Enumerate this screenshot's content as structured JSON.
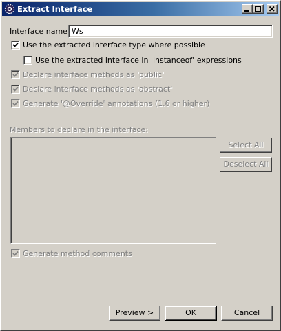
{
  "window": {
    "title": "Extract Interface"
  },
  "form": {
    "interface_name_label": "Interface name:",
    "interface_name_value": "Ws",
    "use_extracted_type": {
      "label": "Use the extracted interface type where possible",
      "checked": true,
      "enabled": true
    },
    "use_in_instanceof": {
      "label": "Use the extracted interface in 'instanceof' expressions",
      "checked": false,
      "enabled": true
    },
    "declare_public": {
      "label": "Declare interface methods as 'public'",
      "checked": true,
      "enabled": false
    },
    "declare_abstract": {
      "label": "Declare interface methods as 'abstract'",
      "checked": true,
      "enabled": false
    },
    "generate_override": {
      "label": "Generate '@Override' annotations (1.6 or higher)",
      "checked": true,
      "enabled": false
    },
    "members_label": "Members to declare in the interface:",
    "generate_comments": {
      "label": "Generate method comments",
      "checked": true,
      "enabled": false
    }
  },
  "buttons": {
    "select_all": "Select All",
    "deselect_all": "Deselect All",
    "preview": "Preview >",
    "ok": "OK",
    "cancel": "Cancel"
  }
}
